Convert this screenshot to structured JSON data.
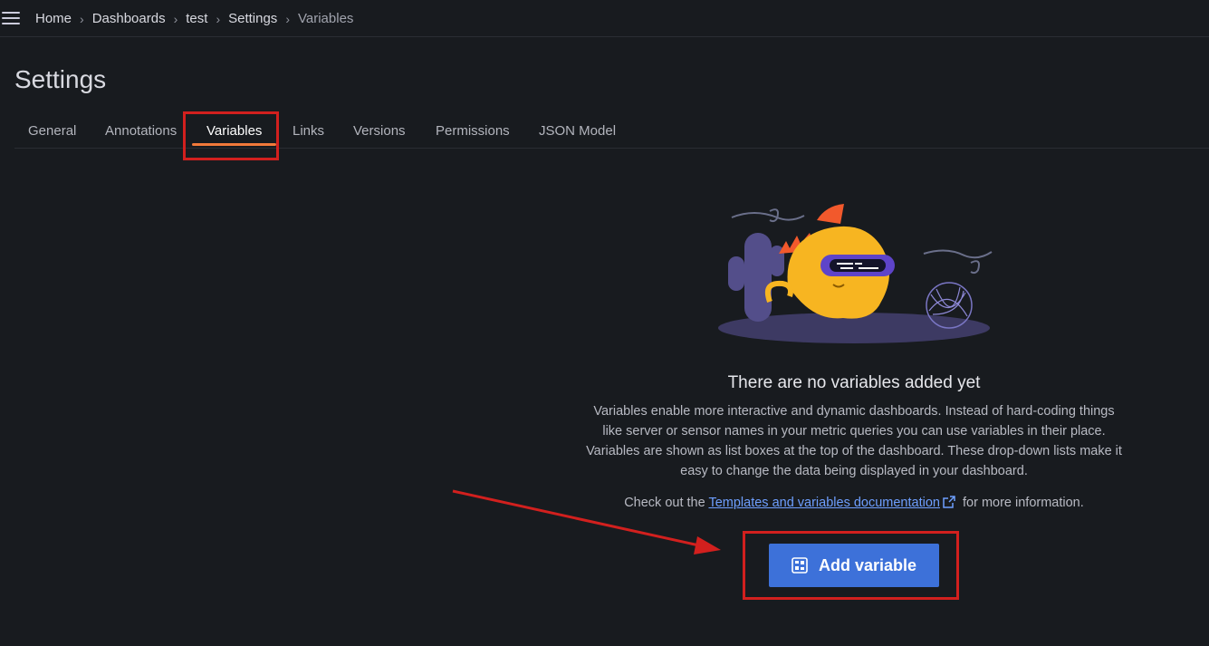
{
  "breadcrumb": {
    "items": [
      "Home",
      "Dashboards",
      "test",
      "Settings"
    ],
    "current": "Variables",
    "separator": "›"
  },
  "page": {
    "title": "Settings"
  },
  "tabs": [
    {
      "label": "General",
      "active": false
    },
    {
      "label": "Annotations",
      "active": false
    },
    {
      "label": "Variables",
      "active": true
    },
    {
      "label": "Links",
      "active": false
    },
    {
      "label": "Versions",
      "active": false
    },
    {
      "label": "Permissions",
      "active": false
    },
    {
      "label": "JSON Model",
      "active": false
    }
  ],
  "empty_state": {
    "title": "There are no variables added yet",
    "description": "Variables enable more interactive and dynamic dashboards. Instead of hard-coding things like server or sensor names in your metric queries you can use variables in their place. Variables are shown as list boxes at the top of the dashboard. These drop-down lists make it easy to change the data being displayed in your dashboard.",
    "docs_prefix": "Check out the ",
    "docs_link": "Templates and variables documentation",
    "docs_suffix": " for more information.",
    "add_button": "Add variable"
  },
  "colors": {
    "background": "#181b1f",
    "accent": "#f27a3a",
    "primary_button": "#3d71d9",
    "link": "#6e9fff",
    "annotation": "#d2201e"
  },
  "icons": {
    "menu": "hamburger-menu-icon",
    "external": "external-link-icon",
    "add": "add-variable-icon"
  }
}
